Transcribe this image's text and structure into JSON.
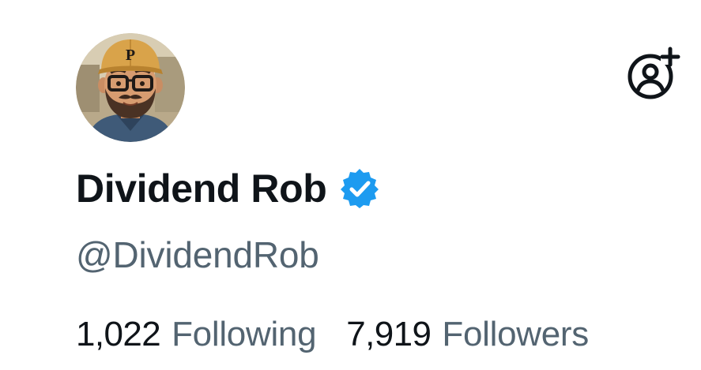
{
  "profile": {
    "display_name": "Dividend Rob",
    "handle": "@DividendRob",
    "verified": true,
    "avatar": {
      "icon": "cartoon-man-cap-glasses-avatar",
      "cap_letter": "P"
    }
  },
  "actions": {
    "follow_icon": "add-user-icon"
  },
  "stats": {
    "following_count": "1,022",
    "following_label": "Following",
    "followers_count": "7,919",
    "followers_label": "Followers"
  },
  "colors": {
    "text_primary": "#0f1419",
    "text_secondary": "#536471",
    "verified_blue": "#1d9bf0"
  }
}
